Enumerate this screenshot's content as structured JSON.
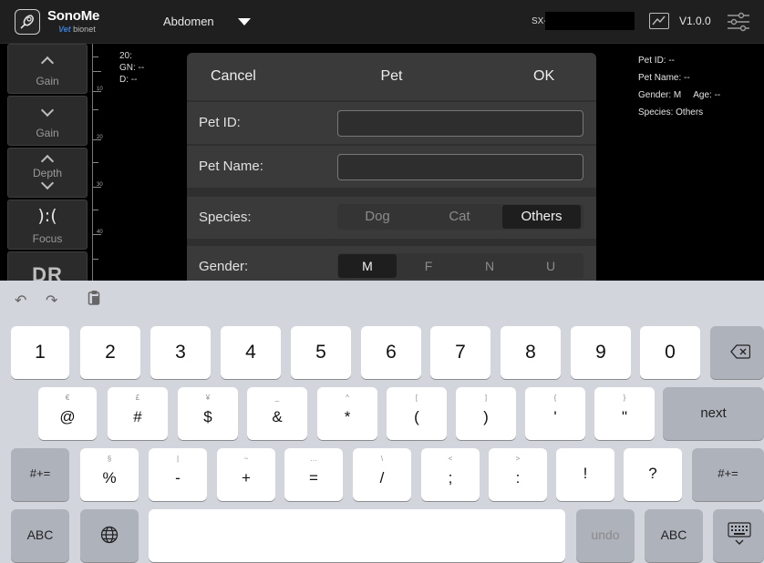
{
  "topbar": {
    "brand": "SonoMe",
    "brand_sub_vet": "Vet",
    "brand_sub_rest": " bionet",
    "preset": "Abdomen",
    "serial_prefix": "SX-",
    "version": "V1.0.0"
  },
  "controls": {
    "gain_up": "Gain",
    "gain_down": "Gain",
    "depth": "Depth",
    "focus_glyph": "):(",
    "focus": "Focus",
    "dr": "DR"
  },
  "ruler": {
    "ticks": [
      "10",
      "20",
      "30",
      "40"
    ]
  },
  "info_left": {
    "line1": "20:",
    "line2": "GN: --",
    "line3": "D: --"
  },
  "info_right": {
    "pet_id": "Pet ID: --",
    "pet_name": "Pet Name: --",
    "gender": "Gender: M",
    "age": "Age: --",
    "species": "Species: Others"
  },
  "dialog": {
    "cancel": "Cancel",
    "title": "Pet",
    "ok": "OK",
    "pet_id_label": "Pet ID:",
    "pet_id_value": "",
    "pet_name_label": "Pet Name:",
    "pet_name_value": "",
    "species_label": "Species:",
    "species_options": [
      "Dog",
      "Cat",
      "Others"
    ],
    "species_selected": "Others",
    "gender_label": "Gender:",
    "gender_options": [
      "M",
      "F",
      "N",
      "U"
    ],
    "gender_selected": "M"
  },
  "keyboard": {
    "row1": [
      "1",
      "2",
      "3",
      "4",
      "5",
      "6",
      "7",
      "8",
      "9",
      "0"
    ],
    "row2_main": [
      "@",
      "#",
      "$",
      "&",
      "*",
      "(",
      ")",
      "'",
      "\""
    ],
    "row2_alt": [
      "€",
      "£",
      "¥",
      "_",
      "^",
      "[",
      "]",
      "{",
      "}"
    ],
    "row2_next": "next",
    "row3_main": [
      "%",
      "-",
      "+",
      "=",
      "/",
      ";",
      ":",
      "!",
      "?"
    ],
    "row3_alt": [
      "§",
      "|",
      "~",
      "…",
      "\\",
      "<",
      ">",
      "",
      ""
    ],
    "row3_left": "#+=",
    "row3_right": "#+=",
    "abc_left": "ABC",
    "undo": "undo",
    "abc_right": "ABC"
  }
}
